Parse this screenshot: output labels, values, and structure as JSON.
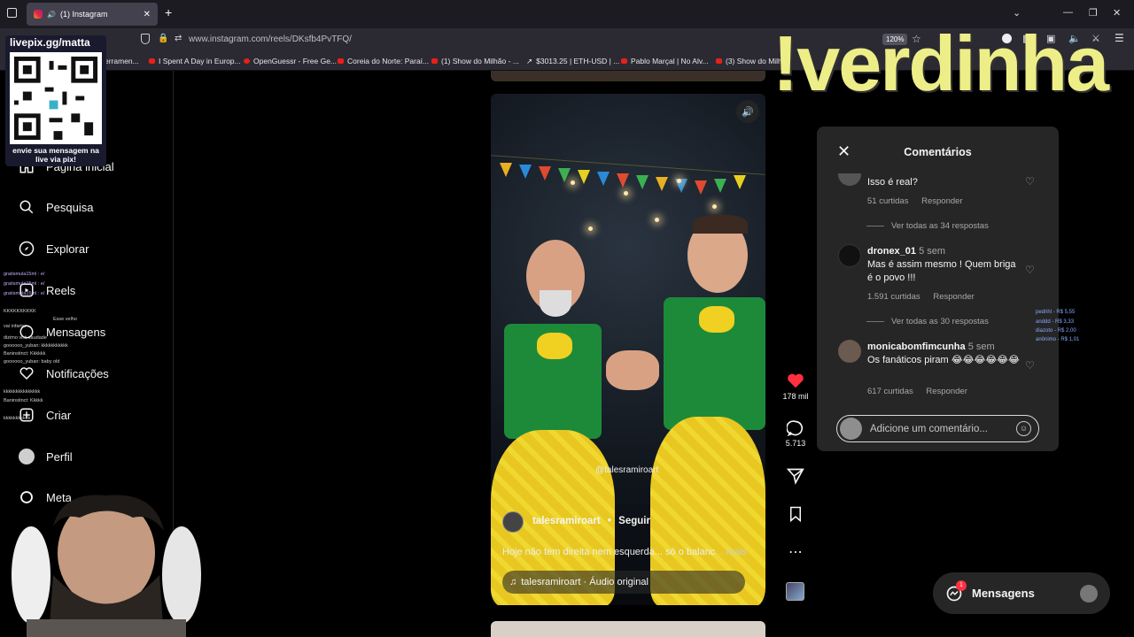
{
  "browser": {
    "tab_title": "(1) Instagram",
    "new_tab": "+",
    "url": "www.instagram.com/reels/DKsfb4PvTFQ/",
    "zoom": "120%",
    "bookmarks": [
      "erramen...",
      "I Spent A Day in Europ...",
      "OpenGuessr - Free Ge...",
      "Coreia do Norte: Paraí...",
      "(1) Show do Milhão - ...",
      "$3013.25 | ETH-USD | ...",
      "Pablo Marçal | No Alv...",
      "(3) Show do Milhã..."
    ]
  },
  "sidebar": {
    "items": [
      {
        "label": "Página inicial",
        "icon": "home-icon"
      },
      {
        "label": "Pesquisa",
        "icon": "search-icon"
      },
      {
        "label": "Explorar",
        "icon": "compass-icon"
      },
      {
        "label": "Reels",
        "icon": "reels-icon"
      },
      {
        "label": "Mensagens",
        "icon": "messenger-icon"
      },
      {
        "label": "Notificações",
        "icon": "heart-icon"
      },
      {
        "label": "Criar",
        "icon": "plus-square-icon"
      },
      {
        "label": "Perfil",
        "icon": "profile-icon"
      },
      {
        "label": "Meta",
        "icon": "meta-icon"
      }
    ]
  },
  "reel": {
    "watermark": "@talesramiroart",
    "author": "talesramiroart",
    "follow": "Seguir",
    "caption": "Hoje não tem direita nem esquerda... só o balanc",
    "more": "... mais",
    "audio": "talesramiroart · Áudio original"
  },
  "actions": {
    "likes": "178 mil",
    "comments": "5.713"
  },
  "comments": {
    "title": "Comentários",
    "items": [
      {
        "user": "",
        "time": "",
        "text": "Isso é real?",
        "likes": "51 curtidas",
        "reply": "Responder",
        "view_replies": "Ver todas as 34 respostas"
      },
      {
        "user": "dronex_01",
        "time": "5 sem",
        "text": "Mas é assim mesmo ! Quem briga é o povo !!!",
        "likes": "1.591 curtidas",
        "reply": "Responder",
        "view_replies": "Ver todas as 30 respostas"
      },
      {
        "user": "monicabomfimcunha",
        "time": "5 sem",
        "text": "Os fanáticos piram 😂😂😂😂😂😂",
        "likes": "617 curtidas",
        "reply": "Responder",
        "view_replies": ""
      }
    ],
    "input_placeholder": "Adicione um comentário..."
  },
  "messages": {
    "label": "Mensagens",
    "badge": "1"
  },
  "overlay": {
    "title": "!verdinha",
    "qr_label": "livepix.gg/matta",
    "qr_caption": "envie sua mensagem na live via pix!",
    "donations": [
      "pedrihl - R$ 5,55",
      "anddd - R$ 3,33",
      "diazoto - R$ 2,00",
      "anônimo - R$ 1,01"
    ],
    "chat": [
      "gratismula15ml : e/",
      "gratismula15ml : e/",
      "gratismula15ml : e/",
      "KKKKKKKKKK",
      "Esse velho",
      "vai infartar ...",
      "dizimo virá saudade",
      "goooooo_yuban: kkkkkkkkkkk",
      "Baninstinct: Kkkkkk",
      "goooooo_yuban: baby old",
      "kkkkkkkkkkkkkkk",
      "Baninstinct: Kkkkk",
      "kkkkkkkkkkk"
    ]
  },
  "colors": {
    "accent_like": "#ff3040",
    "panel_bg": "#262626",
    "overlay_text": "#eeee88"
  }
}
